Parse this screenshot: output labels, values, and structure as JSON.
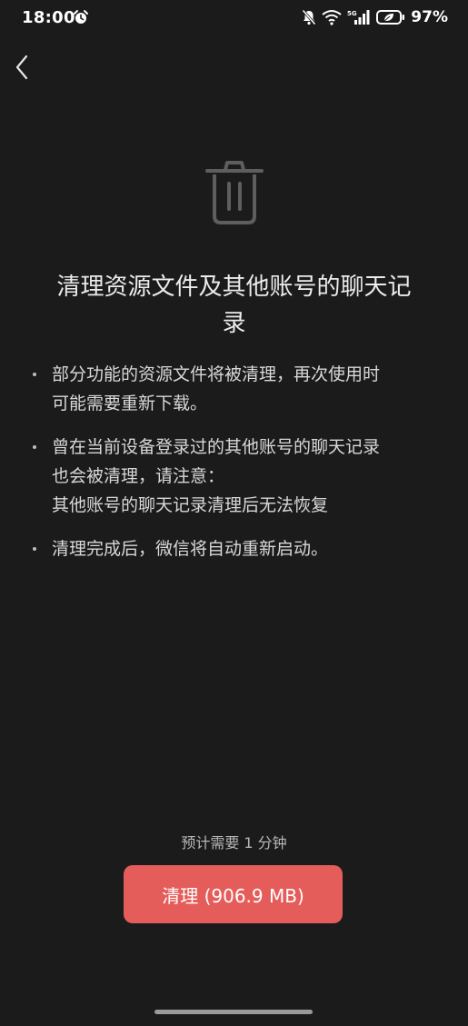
{
  "status_bar": {
    "time": "18:00",
    "battery": "97%"
  },
  "page": {
    "title_lines": [
      "清理资源文件及其他账号的聊天记",
      "录"
    ],
    "bullets": [
      {
        "lines": [
          "部分功能的资源文件将被清理，再次使用时",
          "可能需要重新下载。"
        ]
      },
      {
        "lines": [
          "曾在当前设备登录过的其他账号的聊天记录",
          "也会被清理，请注意：",
          "其他账号的聊天记录清理后无法恢复"
        ]
      },
      {
        "lines": [
          "清理完成后，微信将自动重新启动。"
        ]
      }
    ],
    "estimate_text": "预计需要 1 分钟",
    "clean_button_label": "清理 (906.9 MB)"
  },
  "colors": {
    "background": "#1b1b1b",
    "button": "#e45d5a"
  },
  "icons": [
    "alarm-icon",
    "mute-icon",
    "wifi-icon",
    "signal-icon",
    "battery-saver-icon",
    "back-icon",
    "trash-icon"
  ]
}
